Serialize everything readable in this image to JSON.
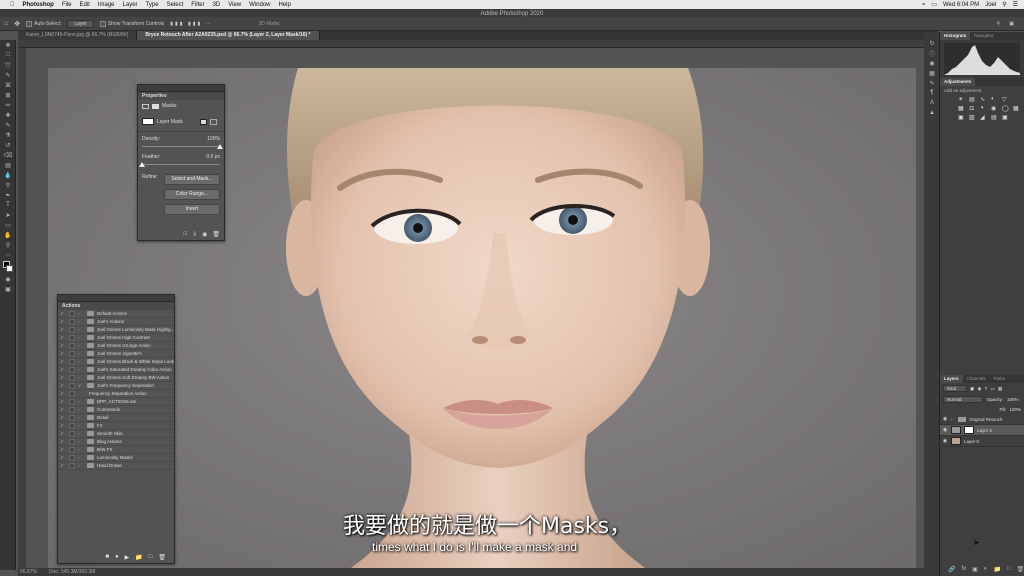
{
  "menubar": {
    "app": "Photoshop",
    "items": [
      "File",
      "Edit",
      "Image",
      "Layer",
      "Type",
      "Select",
      "Filter",
      "3D",
      "View",
      "Window",
      "Help"
    ],
    "clock": "Wed 6:04 PM",
    "user": "Joel"
  },
  "window_title": "Adobe Photoshop 2020",
  "options": {
    "auto_select": "Auto-Select:",
    "auto_select_value": "Layer",
    "show_transform": "Show Transform Controls",
    "mode_3d": "3D Mode:"
  },
  "tabs": [
    {
      "label": "Karen_L9N6745-Pano.jpg @ 66.7% (RGB/8#)"
    },
    {
      "label": "Bryce Retouch After A2A0235.psd @ 66.7% (Layer 2, Layer Mask/16) *"
    }
  ],
  "status": {
    "zoom": "66.67%",
    "doc": "Doc: 145.3M/302.3M"
  },
  "properties": {
    "title": "Properties",
    "section": "Masks",
    "layer_mask": "Layer Mask",
    "density_label": "Density:",
    "density_value": "100%",
    "density_fraction": 1.0,
    "feather_label": "Feather:",
    "feather_value": "0.0 px",
    "feather_fraction": 0.0,
    "refine_label": "Refine:",
    "btn_select_mask": "Select and Mask...",
    "btn_color_range": "Color Range...",
    "btn_invert": "Invert"
  },
  "actions": {
    "title": "Actions",
    "items": [
      {
        "label": "Default Actions",
        "indent": 0,
        "open": false
      },
      {
        "label": "Joel's Actions",
        "indent": 0,
        "open": false
      },
      {
        "label": "Joel Grimes Luminosity Mask Highlig...",
        "indent": 0,
        "open": false
      },
      {
        "label": "Joel Grimes High Contrast",
        "indent": 0,
        "open": false
      },
      {
        "label": "Joel Grimes Grunge Action",
        "indent": 0,
        "open": false
      },
      {
        "label": "Joel Grimes Vignette's",
        "indent": 0,
        "open": false
      },
      {
        "label": "Joel Grimes Black & White Sepia Look",
        "indent": 0,
        "open": false
      },
      {
        "label": "Joel's Saturated Dreamy Color Action",
        "indent": 0,
        "open": false
      },
      {
        "label": "Joel Grimes Soft Dreamy BW Action",
        "indent": 0,
        "open": false
      },
      {
        "label": "Joel's Frequency Separation",
        "indent": 0,
        "open": true
      },
      {
        "label": "Frequency Separation Action",
        "indent": 1,
        "open": false
      },
      {
        "label": "DPP_ACTIONS.atn",
        "indent": 0,
        "open": false
      },
      {
        "label": "Commands",
        "indent": 0,
        "open": false
      },
      {
        "label": "Detail",
        "indent": 0,
        "open": false
      },
      {
        "label": "FX",
        "indent": 0,
        "open": false
      },
      {
        "label": "Smooth Skin",
        "indent": 0,
        "open": false
      },
      {
        "label": "Blog Actions",
        "indent": 0,
        "open": false
      },
      {
        "label": "B/W FX",
        "indent": 0,
        "open": false
      },
      {
        "label": "Luminosity Masks",
        "indent": 0,
        "open": false
      },
      {
        "label": "Hand Drawn",
        "indent": 0,
        "open": false
      }
    ]
  },
  "dock": {
    "histogram_tabs": [
      "Histogram",
      "Navigator"
    ],
    "adjustments_title": "Adjustments",
    "add_adjustment": "Add an adjustment",
    "layers_tabs": [
      "Layers",
      "Channels",
      "Paths"
    ],
    "kind": "Kind",
    "blend_mode": "Normal",
    "opacity_label": "Opacity:",
    "opacity_value": "100%",
    "fill_label": "Fill:",
    "fill_value": "100%",
    "layers": [
      {
        "name": "Original Retouch",
        "type": "group",
        "selected": false
      },
      {
        "name": "Layer 2",
        "type": "masked",
        "selected": true
      },
      {
        "name": "Layer 0",
        "type": "image",
        "selected": false
      }
    ]
  },
  "subtitles": {
    "cn": "我要做的就是做一个Masks，",
    "en": "times what I do is I'll make a mask and"
  }
}
